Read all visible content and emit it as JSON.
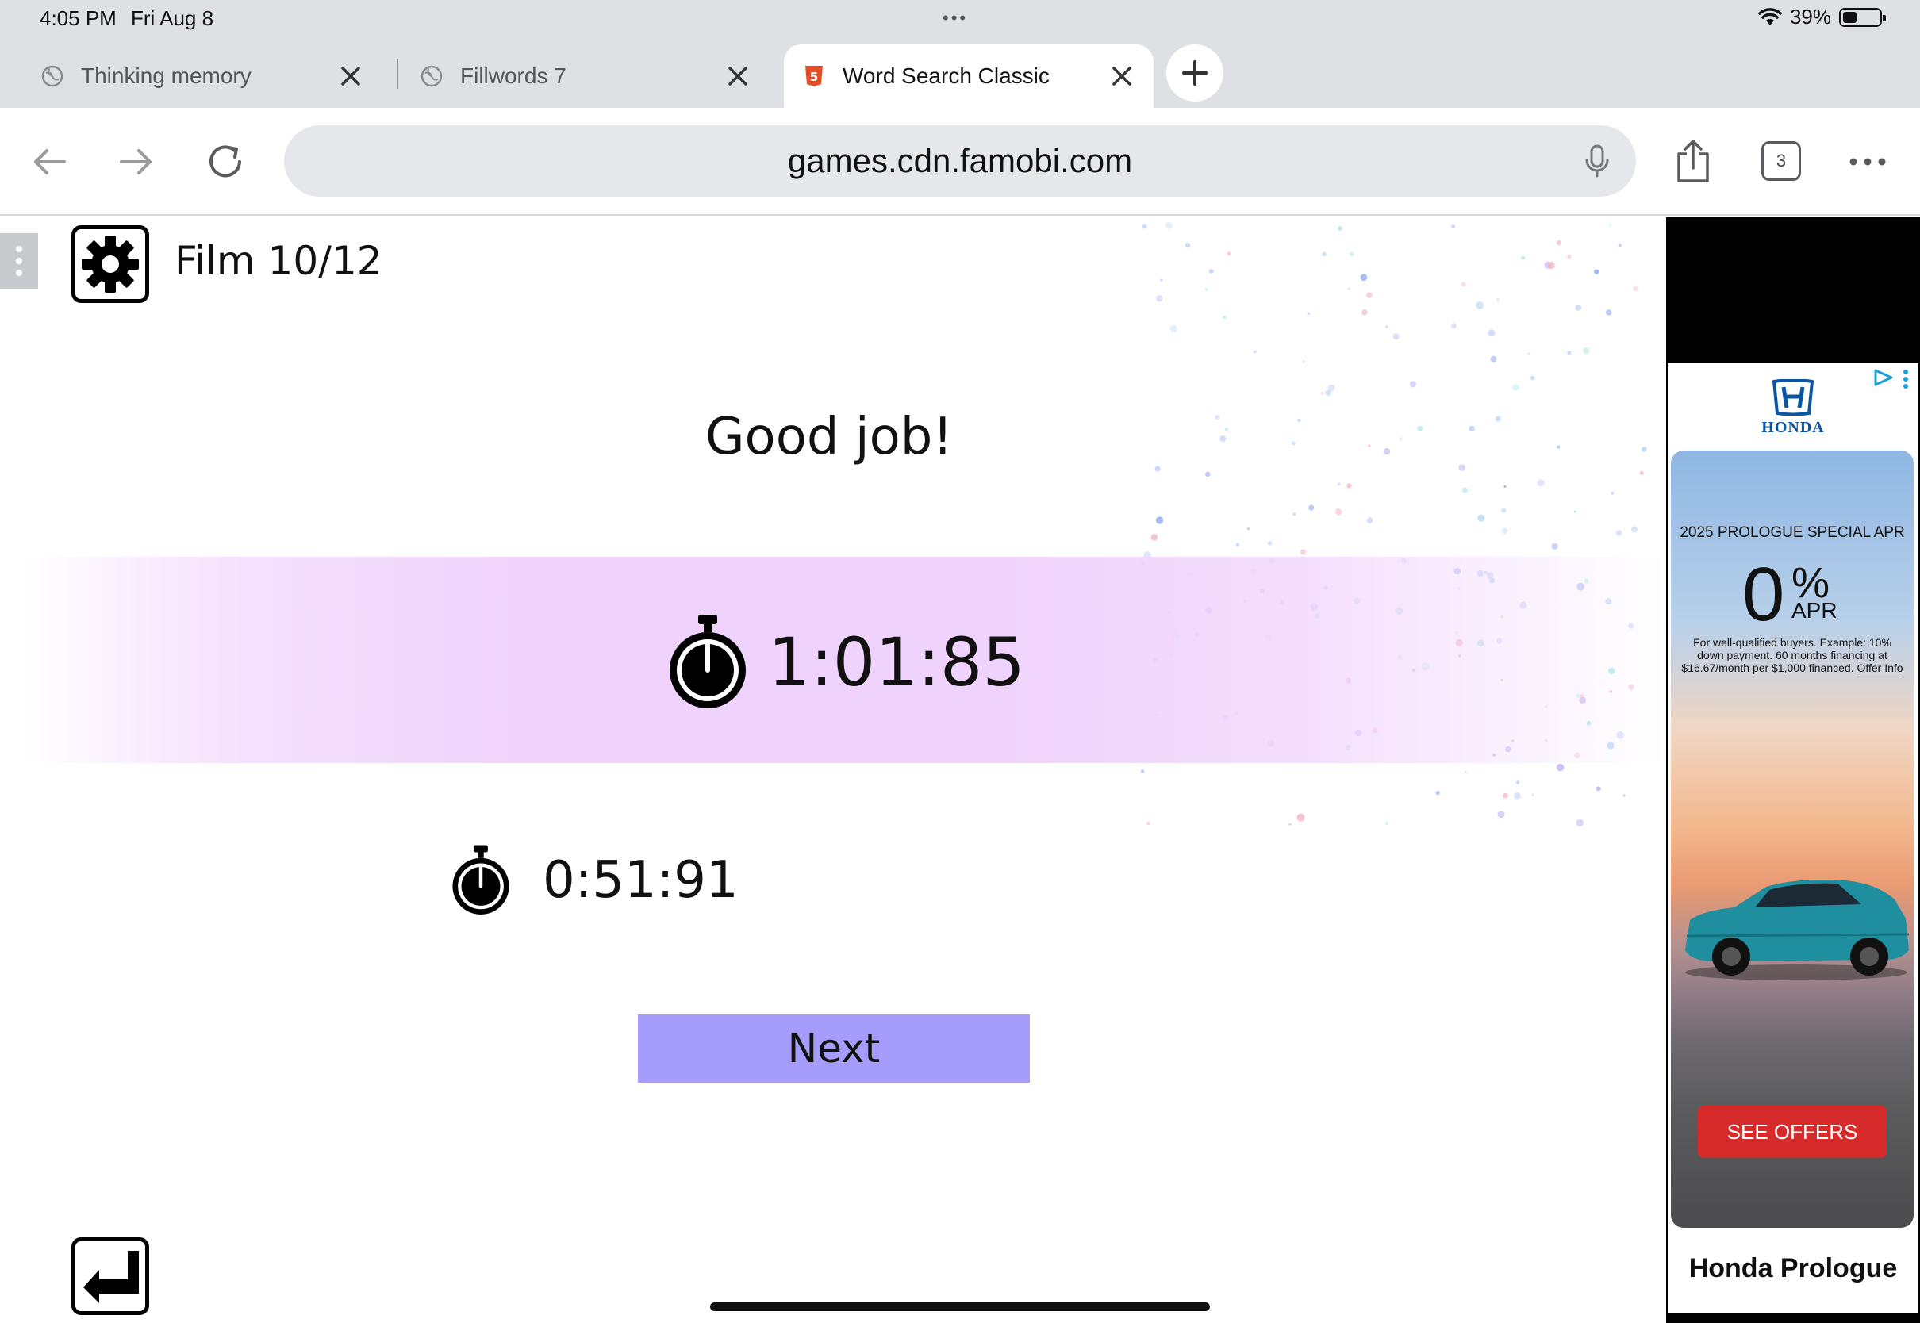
{
  "status_bar": {
    "time": "4:05 PM",
    "date": "Fri Aug 8",
    "battery": "39%",
    "battery_level": 0.39
  },
  "tabs": [
    {
      "title": "Thinking memory",
      "icon": "globe-icon",
      "active": false
    },
    {
      "title": "Fillwords 7",
      "icon": "globe-icon",
      "active": false
    },
    {
      "title": "Word Search Classic",
      "icon": "html5-icon",
      "active": true
    }
  ],
  "toolbar": {
    "url": "games.cdn.famobi.com",
    "tab_count": "3"
  },
  "game": {
    "level_label": "Film 10/12",
    "result_title": "Good job!",
    "current_time": "1:01:85",
    "best_time": "0:51:91",
    "next_label": "Next"
  },
  "ad": {
    "brand": "HONDA",
    "headline": "2025 PROLOGUE SPECIAL APR",
    "rate": "0",
    "rate_symbol": "%",
    "rate_unit": "APR",
    "fine_print": "For well-qualified buyers. Example: 10% down payment. 60 months financing at $16.67/month per $1,000 financed.",
    "offer_info": "Offer Info",
    "cta": "SEE OFFERS",
    "product_name": "Honda Prologue"
  },
  "colors": {
    "next_button": "#a59cfb",
    "time_band": "#efd3fc",
    "see_offers": "#d72b2b",
    "honda_blue": "#0a56a5"
  }
}
